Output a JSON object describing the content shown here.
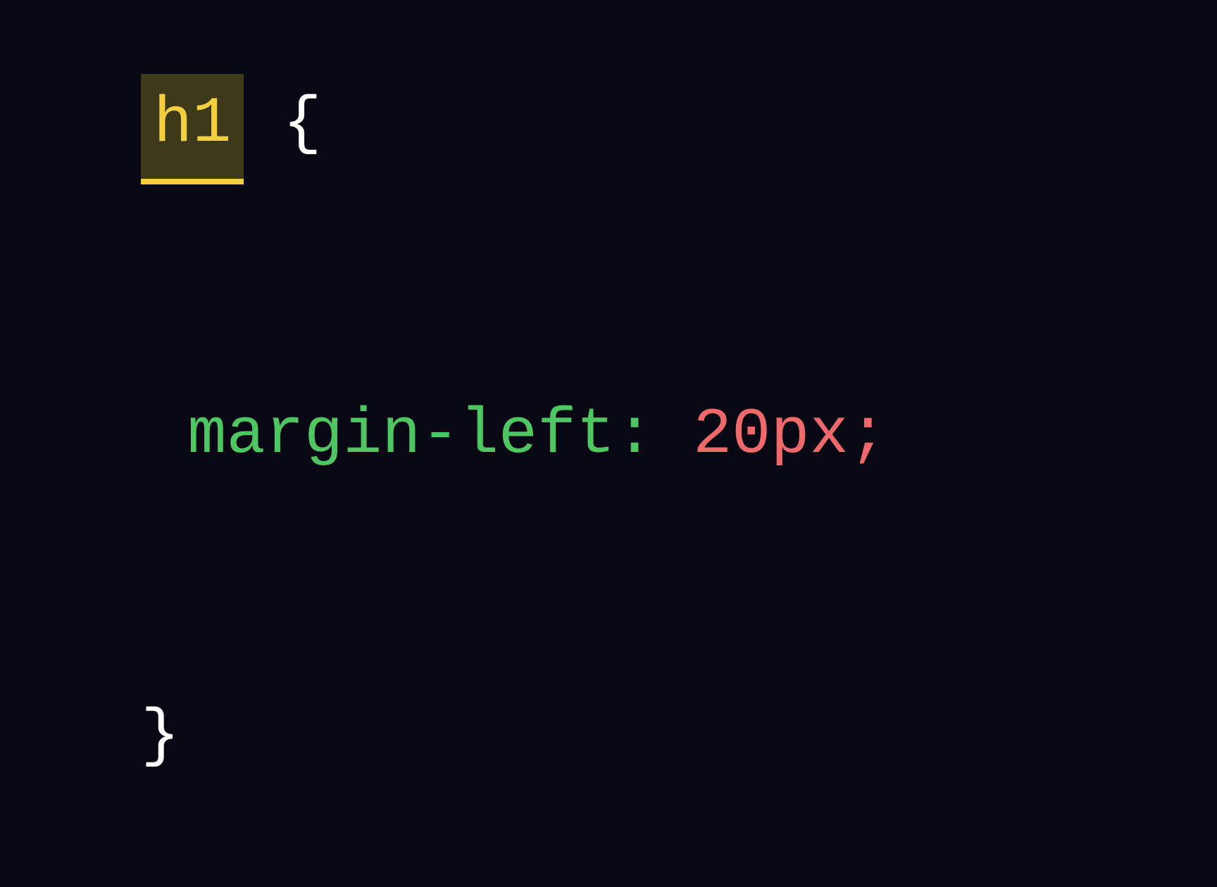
{
  "code": {
    "selector": "h1",
    "brace_open": " {",
    "property": "margin-left:",
    "value": " 20px;",
    "brace_close": "}",
    "colors": {
      "background": "#080814",
      "selector": "#f4d03f",
      "selector_highlight_bg": "#3d3a1a",
      "brace": "#ffffff",
      "property": "#4ec762",
      "value": "#f0696a"
    }
  }
}
